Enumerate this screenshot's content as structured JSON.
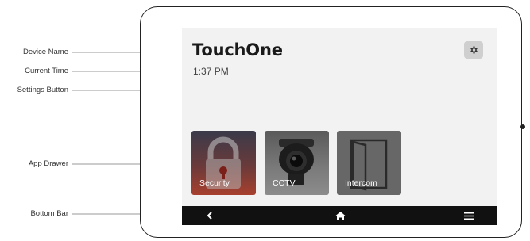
{
  "callouts": {
    "device_name": "Device Name",
    "current_time": "Current Time",
    "settings_button": "Settings Button",
    "app_drawer": "App Drawer",
    "bottom_bar": "Bottom Bar"
  },
  "screen": {
    "device_name": "TouchOne",
    "current_time": "1:37 PM",
    "settings_icon": "gear-icon"
  },
  "apps": [
    {
      "label": "Security",
      "icon": "padlock-icon",
      "color": "#a8402e"
    },
    {
      "label": "CCTV",
      "icon": "camera-icon",
      "color": "#7b7b7b"
    },
    {
      "label": "Intercom",
      "icon": "door-icon",
      "color": "#676767"
    }
  ],
  "bottom_bar": {
    "back_icon": "chevron-left-icon",
    "home_icon": "home-icon",
    "menu_icon": "menu-icon",
    "color": "#111111"
  }
}
